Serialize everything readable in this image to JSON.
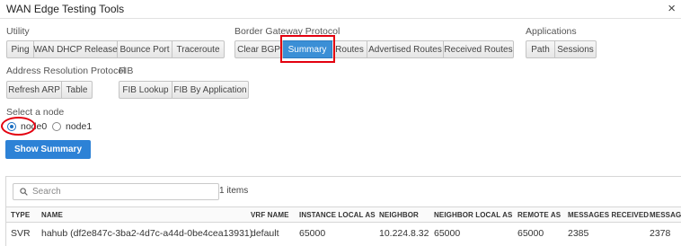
{
  "window": {
    "title": "WAN Edge Testing Tools",
    "close": "×"
  },
  "groups": {
    "utility": {
      "label": "Utility",
      "buttons": [
        "Ping",
        "WAN DHCP Release",
        "Bounce Port",
        "Traceroute"
      ]
    },
    "bgp": {
      "label": "Border Gateway Protocol",
      "buttons": [
        "Clear BGP",
        "Summary",
        "Routes",
        "Advertised Routes",
        "Received Routes"
      ],
      "active": "Summary"
    },
    "applications": {
      "label": "Applications",
      "buttons": [
        "Path",
        "Sessions"
      ]
    },
    "arp": {
      "label": "Address Resolution Protocol",
      "buttons": [
        "Refresh ARP",
        "Table"
      ]
    },
    "fib": {
      "label": "FIB",
      "buttons": [
        "FIB Lookup",
        "FIB By Application"
      ]
    }
  },
  "node_select": {
    "label": "Select a node",
    "options": [
      "node0",
      "node1"
    ],
    "selected": "node0"
  },
  "action": {
    "show_summary": "Show Summary"
  },
  "results": {
    "search_placeholder": "Search",
    "item_count": "1 items",
    "columns": [
      "TYPE",
      "NAME",
      "VRF NAME",
      "INSTANCE LOCAL AS",
      "NEIGHBOR",
      "NEIGHBOR LOCAL AS",
      "REMOTE AS",
      "MESSAGES RECEIVED",
      "MESSAGE"
    ],
    "rows": [
      [
        "SVR",
        "hahub (df2e847c-3ba2-4d7c-a44d-0be4cea13931)",
        "default",
        "65000",
        "10.224.8.32",
        "65000",
        "65000",
        "2385",
        "2378"
      ]
    ]
  },
  "colors": {
    "accent": "#2d82d6",
    "highlight": "#e3000f"
  }
}
